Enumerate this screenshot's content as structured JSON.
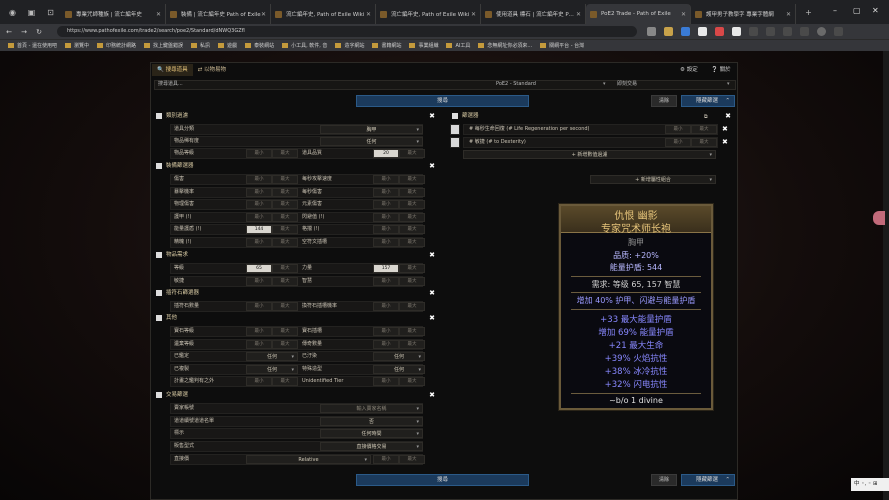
{
  "browser": {
    "tabs": [
      {
        "label": "專業咒師種族 | 流亡編年史",
        "active": false
      },
      {
        "label": "裝備 | 流亡編年史 Path of Exile",
        "active": false
      },
      {
        "label": "流亡編年史, Path of Exile Wiki",
        "active": false
      },
      {
        "label": "流亡編年史, Path of Exile Wiki",
        "active": false
      },
      {
        "label": "使用道具 標石 | 流亡編年史 Path",
        "active": false
      },
      {
        "label": "PoE2 Trade - Path of Exile",
        "active": true
      },
      {
        "label": "護甲男子教學字 專業字體網",
        "active": false
      }
    ],
    "new_tab": "+",
    "url": "https://www.pathofexile.com/trade2/search/poe2/Standard/dNWQ3GZfl",
    "bookmarks": [
      "首頁 - 還在使用吧",
      "瀏覽中",
      "印務統計網路",
      "找上鍵盤錯誤",
      "私訊",
      "遊戲",
      "泰裝網站",
      "小工具, 軟件, 音",
      "造字網站",
      "書籍網站",
      "事業組織",
      "AI工具",
      "念無網址你必須來...",
      "關網平台 - 台灣"
    ]
  },
  "trade": {
    "tab_search": "搜尋道具",
    "tab_exchange": "以物易物",
    "settings": "設定",
    "about": "關於",
    "search_placeholder": "搜尋道具...",
    "league": "PoE2 - Standard",
    "status": "即刻交易",
    "search_btn": "搜尋",
    "clear_btn": "清除",
    "hide_filter_btn": "隱藏篩選"
  },
  "left": {
    "type_section": "類別過濾",
    "category_label": "道具分類",
    "category_value": "胸甲",
    "rarity_label": "物品稀有度",
    "rarity_value": "任何",
    "ilvl_label": "物品等級",
    "quality_label": "道具品質",
    "quality_min": "20",
    "equip_section": "裝備篩選器",
    "equip_rows": [
      {
        "l": "傷害",
        "r": "每秒攻擊速度"
      },
      {
        "l": "暴擊機率",
        "r": "每秒傷害"
      },
      {
        "l": "物理傷害",
        "r": "元素傷害"
      },
      {
        "l": "護甲 (!)",
        "r": "閃避值 (!)"
      },
      {
        "l": "能量護盾 (!)",
        "r": "格擋 (!)"
      },
      {
        "l": "精魄 (!)",
        "r": "空符文插槽"
      }
    ],
    "es_min": "144",
    "req_section": "物品需求",
    "level_label": "等級",
    "level_value": "65",
    "str_label": "力量",
    "str_value": "157",
    "dex_label": "敏捷",
    "int_label": "智慧",
    "socket_section": "插符石篩選器",
    "socket_label": "插符石數量",
    "socket_r": "換符石插槽機率",
    "misc_section": "其他",
    "misc_rows": [
      {
        "l": "寶石等級",
        "r": "寶石插槽"
      },
      {
        "l": "遺棄等級",
        "r": "傳奇數量"
      },
      {
        "l": "已鑑定",
        "lv": "任何",
        "r": "已汙染",
        "rv": "任何"
      },
      {
        "l": "已複製",
        "lv": "任何",
        "r": "特殊造型",
        "rv": "任何"
      },
      {
        "l": "計畫之鑑判有之外",
        "r": "Unidentified Tier"
      }
    ],
    "trade_section": "交易篩選",
    "seller_label": "賣家帳號",
    "seller_value": "輸入賣家名稱",
    "collapse_label": "道道續號道道名單",
    "collapse_value": "否",
    "listed_label": "標示",
    "listed_value": "任何時間",
    "sale_type_label": "販售型式",
    "sale_type_value": "直接價格交易",
    "price_label": "直接價",
    "price_mode": "Relative"
  },
  "right": {
    "stat_section": "篩選器",
    "stats": [
      "# 每秒生命回復 (# Life Regeneration per second)",
      "# 敏捷 (# to Dexterity)"
    ],
    "add_stat": "+ 新增數值過濾",
    "add_group": "+ 新增屬性組合",
    "min": "最小",
    "max": "最大"
  },
  "minmax": {
    "min": "最小",
    "max": "最大"
  },
  "item": {
    "name1": "仇恨 幽影",
    "name2": "专家咒术师长袍",
    "type": "胸甲",
    "quality": "品质: +20%",
    "es": "能量护盾: 544",
    "req": "需求: 等级 65, 157 智慧",
    "implicit": "增加 40% 护甲、闪避与能量护盾",
    "mods": [
      "+33 最大能量护盾",
      "增加 69% 能量护盾",
      "+21 最大生命",
      "+39% 火焰抗性",
      "+38% 冰冷抗性",
      "+32% 闪电抗性"
    ],
    "price": "~b/o 1 divine"
  },
  "widget": "中 ◦, ◦ ⊞",
  "colors": {
    "accent": "#1b3a5c",
    "gold": "#e6c47a",
    "mod": "#8888ff",
    "bg": "#0d0d0d"
  }
}
